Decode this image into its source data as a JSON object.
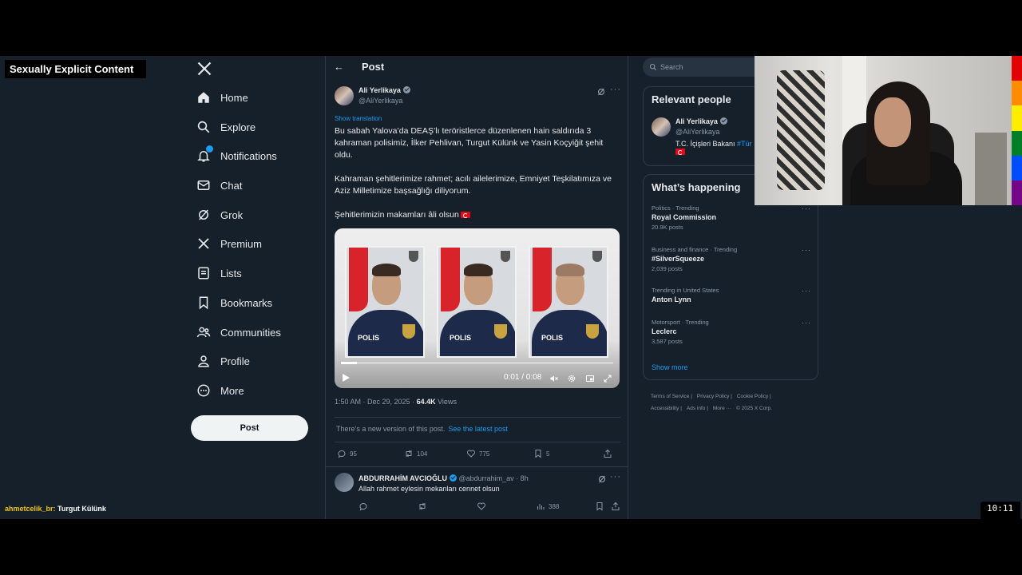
{
  "overlay": {
    "content_label": "Sexually Explicit Content",
    "chat_user": "ahmetcelik_br:",
    "chat_message": "Turgut Külünk",
    "clock": "10:11"
  },
  "nav": {
    "items": [
      {
        "label": "Home",
        "icon": "home-icon"
      },
      {
        "label": "Explore",
        "icon": "search-icon"
      },
      {
        "label": "Notifications",
        "icon": "bell-icon"
      },
      {
        "label": "Chat",
        "icon": "mail-icon"
      },
      {
        "label": "Grok",
        "icon": "grok-icon"
      },
      {
        "label": "Premium",
        "icon": "x-logo-icon"
      },
      {
        "label": "Lists",
        "icon": "list-icon"
      },
      {
        "label": "Bookmarks",
        "icon": "bookmark-icon"
      },
      {
        "label": "Communities",
        "icon": "people-icon"
      },
      {
        "label": "Profile",
        "icon": "person-icon"
      },
      {
        "label": "More",
        "icon": "more-circle-icon"
      }
    ],
    "post_button": "Post"
  },
  "main": {
    "header_title": "Post",
    "author": {
      "name": "Ali Yerlikaya",
      "handle": "@AliYerlikaya"
    },
    "show_translation": "Show translation",
    "paragraphs": [
      "Bu sabah Yalova’da DEAŞ’lı teröristlerce düzenlenen hain saldırıda 3 kahraman polisimiz, İlker Pehlivan, Turgut Külünk ve Yasin Koçyiğit şehit oldu.",
      "Kahraman şehitlerimize rahmet; acılı ailelerimize, Emniyet Teşkilatımıza ve Aziz Milletimize başsağlığı diliyorum.",
      "Şehitlerimizin makamları âli olsun"
    ],
    "video": {
      "time": "0:01 / 0:08",
      "progress": 0.06,
      "badge": "POLIS"
    },
    "timestamp": "1:50 AM · Dec 29, 2025 · ",
    "views_count": "64.4K",
    "views_label": " Views",
    "new_version_text": "There’s a new version of this post.",
    "new_version_link": "See the latest post",
    "stats": {
      "replies": "95",
      "reposts": "104",
      "likes": "775",
      "bookmarks": "5"
    },
    "reply": {
      "name": "ABDURRAHİM AVCIOĞLU",
      "handle": "@abdurrahim_av · 8h",
      "text": "Allah rahmet eylesin mekanları cennet olsun",
      "views": "388"
    }
  },
  "right": {
    "search_placeholder": "Search",
    "relevant_title": "Relevant people",
    "person": {
      "name": "Ali Yerlikaya",
      "handle": "@AliYerlikaya",
      "bio": "T.C. İçişleri Bakanı ",
      "bio_link": "#Tür"
    },
    "happening_title": "What’s happening",
    "trends": [
      {
        "category": "Politics · Trending",
        "name": "Royal Commission",
        "count": "20.9K posts"
      },
      {
        "category": "Business and finance · Trending",
        "name": "#SilverSqueeze",
        "count": "2,039 posts"
      },
      {
        "category": "Trending in United States",
        "name": "Anton Lynn",
        "count": ""
      },
      {
        "category": "Motorsport · Trending",
        "name": "Leclerc",
        "count": "3,587 posts"
      }
    ],
    "show_more": "Show more",
    "footer": [
      "Terms of Service |",
      "Privacy Policy |",
      "Cookie Policy |",
      "Accessibility |",
      "Ads info |",
      "More ···",
      "© 2025 X Corp."
    ]
  },
  "colors": {
    "accent": "#1d9bf0",
    "background": "#15202b",
    "border": "#2f3b47",
    "muted": "#8b98a5"
  }
}
